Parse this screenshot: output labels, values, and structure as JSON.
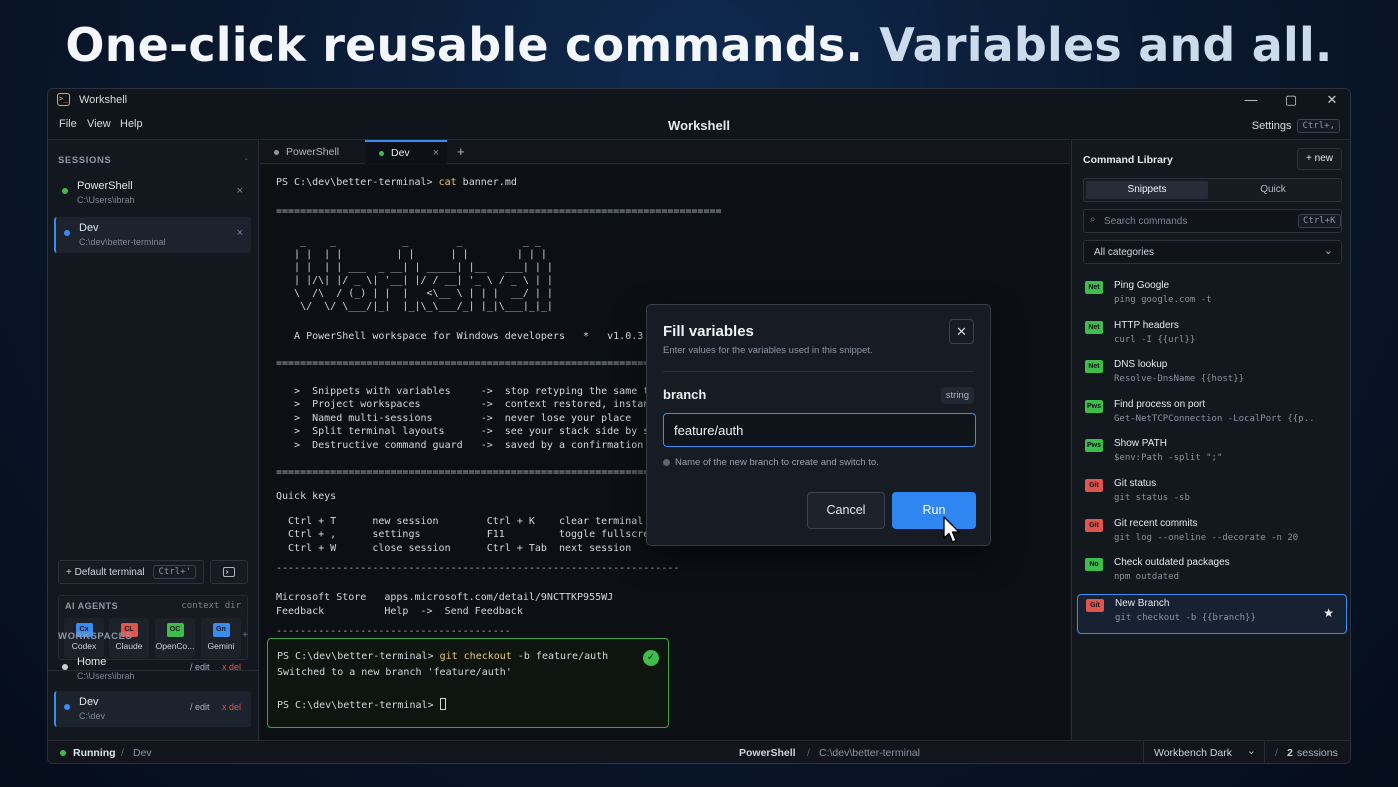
{
  "headline": {
    "part1": "One-click reusable commands.",
    "part2": "Variables and all."
  },
  "app": {
    "title": "Workshell",
    "center_title": "Workshell",
    "logo_glyph": ">_"
  },
  "window_controls": {
    "minimize": "—",
    "maximize": "▢",
    "close": "✕"
  },
  "menu": {
    "file": "File",
    "view": "View",
    "help": "Help"
  },
  "settings": {
    "label": "Settings",
    "shortcut": "Ctrl+,"
  },
  "sidebar": {
    "sessions_header": "SESSIONS",
    "sessions_header_action": "-",
    "sessions": [
      {
        "name": "PowerShell",
        "path": "C:\\Users\\ibrah",
        "close": "×",
        "dot_color": "#3fbd4a"
      },
      {
        "name": "Dev",
        "path": "C:\\dev\\better-terminal",
        "close": "×",
        "dot_color": "#3a8df0"
      }
    ],
    "default_terminal": {
      "label": "+ Default terminal",
      "shortcut": "Ctrl+'"
    },
    "agents_header": "AI AGENTS",
    "agents_header_right": "context dir",
    "agents": [
      {
        "badge": "Cx",
        "label": "Codex",
        "color": "#3a8df0"
      },
      {
        "badge": "CL",
        "label": "Claude",
        "color": "#e0554d"
      },
      {
        "badge": "OC",
        "label": "OpenCo...",
        "color": "#3fbd4a"
      },
      {
        "badge": "Gn",
        "label": "Gemini",
        "color": "#3a8df0"
      }
    ],
    "workspaces_header": "WORKSPACES",
    "workspaces_header_action": "+",
    "workspaces": [
      {
        "name": "Home",
        "path": "C:\\Users\\ibrah",
        "edit": "/ edit",
        "del": "x del"
      },
      {
        "name": "Dev",
        "path": "C:\\dev",
        "edit": "/ edit",
        "del": "x del"
      }
    ]
  },
  "tabs": [
    {
      "label": "PowerShell",
      "dot_color": "#8b95a3"
    },
    {
      "label": "Dev",
      "dot_color": "#3fbd4a",
      "close": "×"
    }
  ],
  "tab_add": "+",
  "terminal": {
    "prompt1": "PS C:\\dev\\better-terminal>",
    "cmd1": "cat",
    "arg1": "banner.md",
    "rule1": "==========================================================================",
    "ascii": [
      "    _    _           _        _          _ _",
      "   | |  | |         | |      | |        | | |",
      "   | |  | | ___  _ __| | _____| |__   ___| | |",
      "   | |/\\| |/ _ \\| '__| |/ / __| '_ \\ / _ \\ | |",
      "   \\  /\\  / (_) | |  |   <\\__ \\ | | |  __/ | |",
      "    \\/  \\/ \\___/|_|  |_|\\_\\___/_| |_|\\___|_|_|"
    ],
    "tagline": "   A PowerShell workspace for Windows developers   *   v1.0.3",
    "rule2": "==========================================================================",
    "features": [
      "   >  Snippets with variables     ->  stop retyping the same things",
      "   >  Project workspaces          ->  context restored, instantly",
      "   >  Named multi-sessions        ->  never lose your place",
      "   >  Split terminal layouts      ->  see your stack side by side",
      "   >  Destructive command guard   ->  saved by a confirmation"
    ],
    "rule3": "==========================================================================",
    "quick_keys_title": "Quick keys",
    "quick_keys": [
      "  Ctrl + T      new session        Ctrl + K    clear terminal",
      "  Ctrl + ,      settings           F11         toggle fullscreen",
      "  Ctrl + W      close session      Ctrl + Tab  next session"
    ],
    "rule4": "-------------------------------------------------------------------",
    "store_line": "Microsoft Store   apps.microsoft.com/detail/9NCTTKP955WJ",
    "feedback_line": "Feedback          Help  ->  Send Feedback",
    "rule5": "---------------------------------------",
    "result_prompt": "PS C:\\dev\\better-terminal>",
    "result_cmd": "git checkout",
    "result_args": "-b feature/auth",
    "result_output": "Switched to a new branch 'feature/auth'",
    "result_prompt2": "PS C:\\dev\\better-terminal>",
    "check_glyph": "✓"
  },
  "dialog": {
    "title": "Fill variables",
    "subtitle": "Enter values for the variables used in this snippet.",
    "close": "✕",
    "var_name": "branch",
    "var_type": "string",
    "var_value": "feature/auth",
    "hint": "Name of the new branch to create and switch to.",
    "cancel": "Cancel",
    "run": "Run"
  },
  "command_library": {
    "title": "Command Library",
    "new_button": "+ new",
    "tabs": [
      "Snippets",
      "Quick"
    ],
    "search_placeholder": "Search commands",
    "search_shortcut": "Ctrl+K",
    "category_select": "All categories",
    "snippets": [
      {
        "cat": "Net",
        "cat_color": "#3fbd4a",
        "name": "Ping Google",
        "cmd": "ping google.com -t"
      },
      {
        "cat": "Net",
        "cat_color": "#3fbd4a",
        "name": "HTTP headers",
        "cmd": "curl -I {{url}}"
      },
      {
        "cat": "Net",
        "cat_color": "#3fbd4a",
        "name": "DNS lookup",
        "cmd": "Resolve-DnsName {{host}}"
      },
      {
        "cat": "Pws",
        "cat_color": "#3fbd4a",
        "name": "Find process on port",
        "cmd": "Get-NetTCPConnection -LocalPort {{p.."
      },
      {
        "cat": "Pws",
        "cat_color": "#3fbd4a",
        "name": "Show PATH",
        "cmd": "$env:Path -split \";\""
      },
      {
        "cat": "Git",
        "cat_color": "#e0554d",
        "name": "Git status",
        "cmd": "git status -sb"
      },
      {
        "cat": "Git",
        "cat_color": "#e0554d",
        "name": "Git recent commits",
        "cmd": "git log --oneline --decorate -n 20"
      },
      {
        "cat": "No",
        "cat_color": "#3fbd4a",
        "name": "Check outdated packages",
        "cmd": "npm outdated"
      },
      {
        "cat": "Git",
        "cat_color": "#e0554d",
        "name": "New Branch",
        "cmd": "git checkout -b {{branch}}",
        "star": "★"
      }
    ]
  },
  "statusbar": {
    "status": "Running",
    "sep1": "/",
    "session": "Dev",
    "shell": "PowerShell",
    "sep2": "/",
    "path": "C:\\dev\\better-terminal",
    "theme": "Workbench Dark",
    "sep3": "/",
    "sessions_count": "2",
    "sessions_label": "sessions"
  }
}
